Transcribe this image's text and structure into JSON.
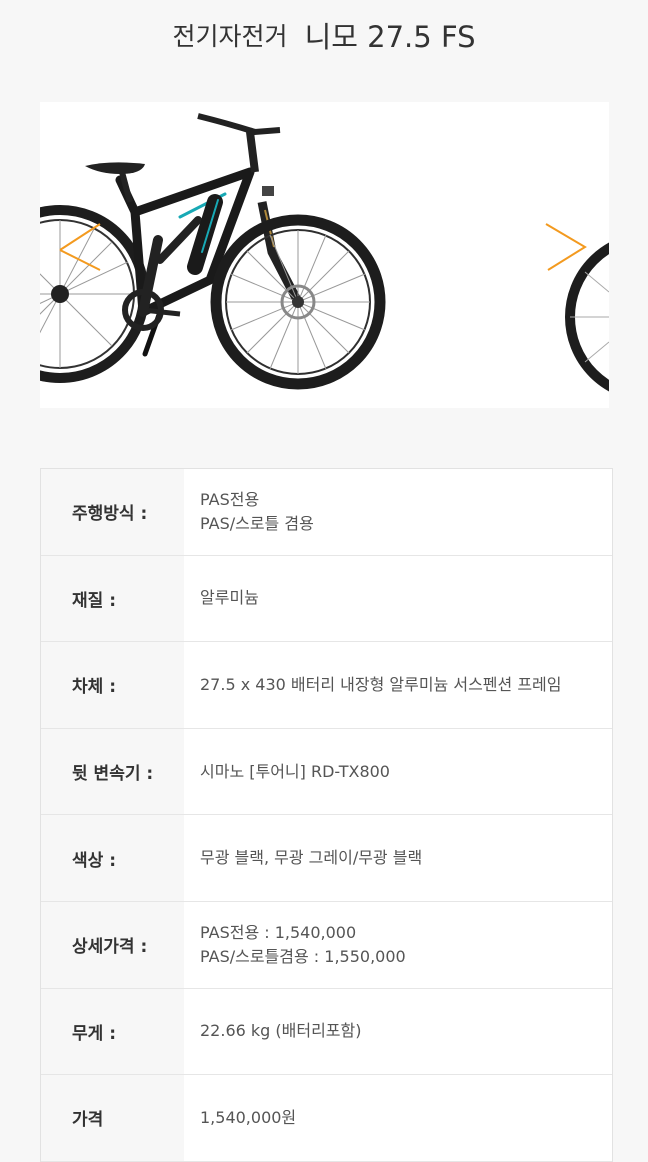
{
  "header": {
    "category": "전기자전거",
    "model": "니모 27.5 FS"
  },
  "slider": {
    "image_icon": "electric-bike-photo",
    "slide_count": 2,
    "active_slide": 1,
    "accent_color": "#f39a1f"
  },
  "specs": [
    {
      "label": "주행방식 :",
      "lines": [
        "PAS전용",
        "PAS/스로틀 겸용"
      ]
    },
    {
      "label": "재질 :",
      "lines": [
        "알루미늄"
      ]
    },
    {
      "label": "차체 :",
      "lines": [
        "27.5 x 430 배터리 내장형 알루미늄 서스펜션 프레임"
      ]
    },
    {
      "label": "뒷 변속기 :",
      "lines": [
        "시마노 [투어니] RD-TX800"
      ]
    },
    {
      "label": "색상 :",
      "lines": [
        "무광 블랙, 무광 그레이/무광 블랙"
      ]
    },
    {
      "label": "상세가격 :",
      "lines": [
        "PAS전용 : 1,540,000",
        "PAS/스로틀겸용 : 1,550,000"
      ]
    },
    {
      "label": "무게 :",
      "lines": [
        "22.66 kg (배터리포함)"
      ]
    },
    {
      "label": "가격",
      "lines": [
        "1,540,000원"
      ]
    }
  ]
}
